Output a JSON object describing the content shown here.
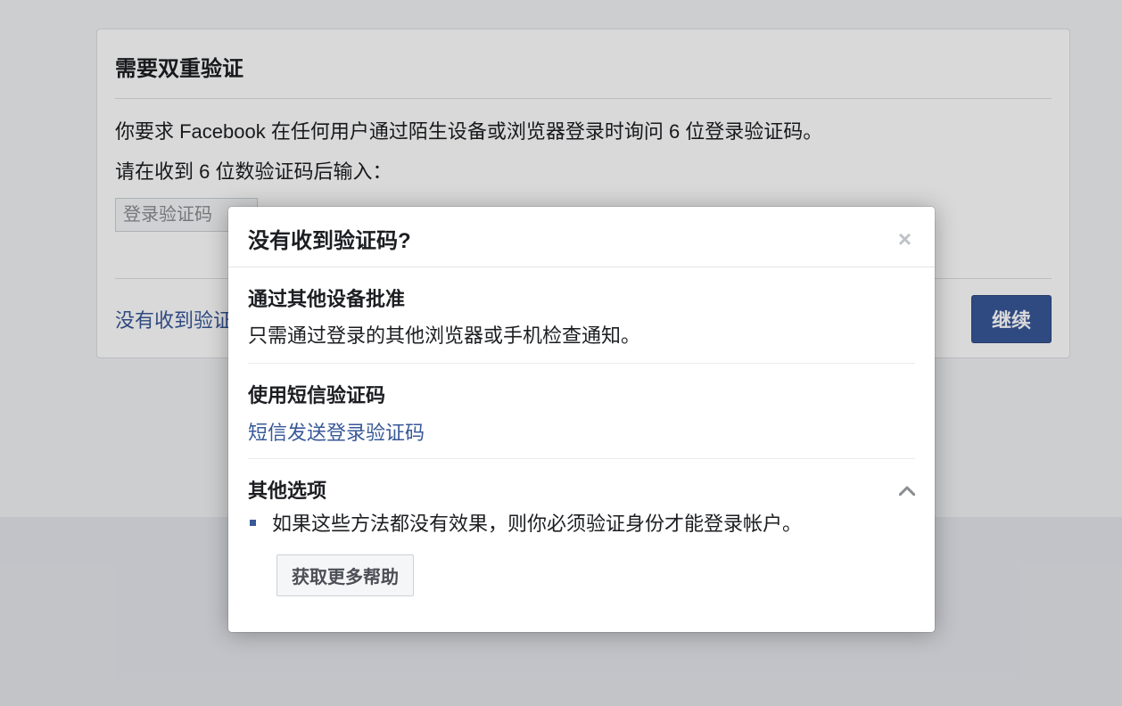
{
  "panel": {
    "title": "需要双重验证",
    "line1": "你要求 Facebook 在任何用户通过陌生设备或浏览器登录时询问 6 位登录验证码。",
    "line2": "请在收到 6 位数验证码后输入：",
    "placeholder": "登录验证码",
    "help_link": "没有收到验证",
    "continue_label": "继续"
  },
  "modal": {
    "title": "没有收到验证码?",
    "section_approve": {
      "title": "通过其他设备批准",
      "text": "只需通过登录的其他浏览器或手机检查通知。"
    },
    "section_sms": {
      "title": "使用短信验证码",
      "link": "短信发送登录验证码"
    },
    "section_other": {
      "title": "其他选项",
      "bullet": "如果这些方法都没有效果，则你必须验证身份才能登录帐户。",
      "button": "获取更多帮助"
    }
  }
}
